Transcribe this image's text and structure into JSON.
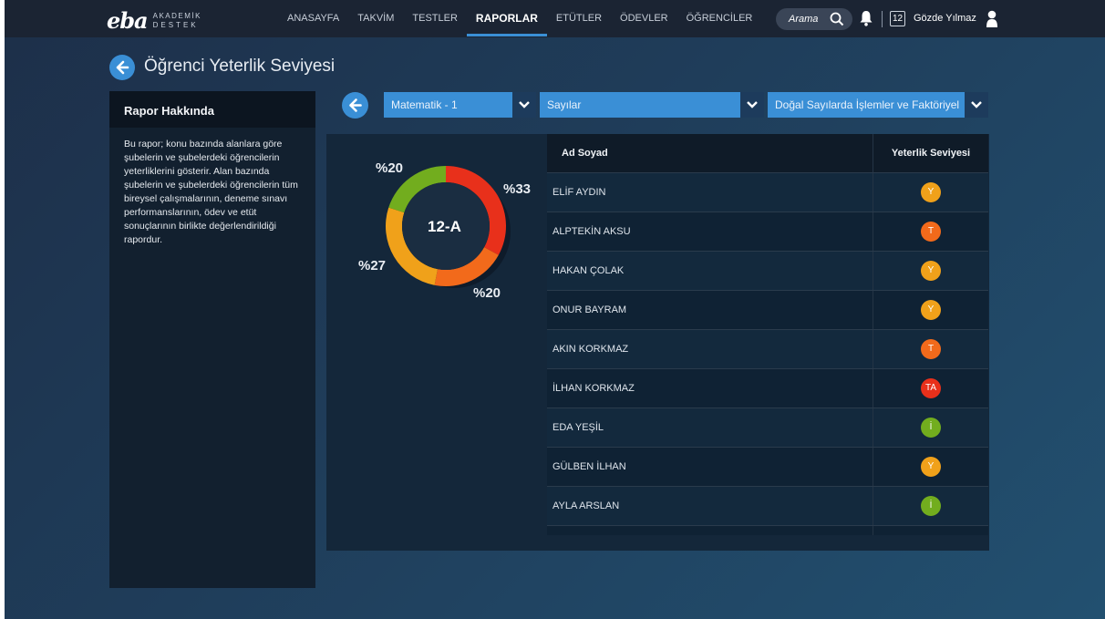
{
  "app": {
    "logo_main": "eba",
    "logo_sub1": "AKADEMİK",
    "logo_sub2": "DESTEK"
  },
  "nav": {
    "items": [
      {
        "label": "ANASAYFA",
        "active": false
      },
      {
        "label": "TAKVİM",
        "active": false
      },
      {
        "label": "TESTLER",
        "active": false
      },
      {
        "label": "RAPORLAR",
        "active": true
      },
      {
        "label": "ETÜTLER",
        "active": false
      },
      {
        "label": "ÖDEVLER",
        "active": false
      },
      {
        "label": "ÖĞRENCİLER",
        "active": false
      }
    ]
  },
  "header": {
    "search_placeholder": "Arama",
    "grade_badge": "12",
    "user_name": "Gözde Yılmaz"
  },
  "page": {
    "title": "Öğrenci Yeterlik Seviyesi"
  },
  "about": {
    "title": "Rapor Hakkında",
    "text": "Bu rapor; konu bazında alanlara göre şubelerin ve şubelerdeki öğrencilerin yeterliklerini gösterir. Alan bazında şubelerin ve şubelerdeki öğrencilerin tüm bireysel çalışmalarının, deneme sınavı performanslarının, ödev ve etüt sonuçlarının birlikte değerlendirildiği rapordur."
  },
  "filters": {
    "course": "Matematik - 1",
    "unit": "Sayılar",
    "topic": "Doğal Sayılarda İşlemler ve Faktöriyel"
  },
  "chart_data": {
    "type": "pie",
    "center_label": "12-A",
    "slices": [
      {
        "label": "%33",
        "value": 33,
        "color": "#e8301b"
      },
      {
        "label": "%20",
        "value": 20,
        "color": "#f26a1b"
      },
      {
        "label": "%27",
        "value": 27,
        "color": "#f0a11a"
      },
      {
        "label": "%20",
        "value": 20,
        "color": "#72ad1e"
      }
    ]
  },
  "table": {
    "col_name": "Ad Soyad",
    "col_level": "Yeterlik Seviyesi",
    "rows": [
      {
        "name": "ELİF AYDIN",
        "level": "Y",
        "color": "#f0a11a"
      },
      {
        "name": "ALPTEKİN AKSU",
        "level": "T",
        "color": "#f26a1b"
      },
      {
        "name": "HAKAN ÇOLAK",
        "level": "Y",
        "color": "#f0a11a"
      },
      {
        "name": "ONUR BAYRAM",
        "level": "Y",
        "color": "#f0a11a"
      },
      {
        "name": "AKIN KORKMAZ",
        "level": "T",
        "color": "#f26a1b"
      },
      {
        "name": "İLHAN KORKMAZ",
        "level": "TA",
        "color": "#e8301b"
      },
      {
        "name": "EDA YEŞİL",
        "level": "İ",
        "color": "#72ad1e"
      },
      {
        "name": "GÜLBEN İLHAN",
        "level": "Y",
        "color": "#f0a11a"
      },
      {
        "name": "AYLA ARSLAN",
        "level": "İ",
        "color": "#72ad1e"
      },
      {
        "name": "",
        "level": "",
        "color": "#f26a1b"
      }
    ]
  }
}
